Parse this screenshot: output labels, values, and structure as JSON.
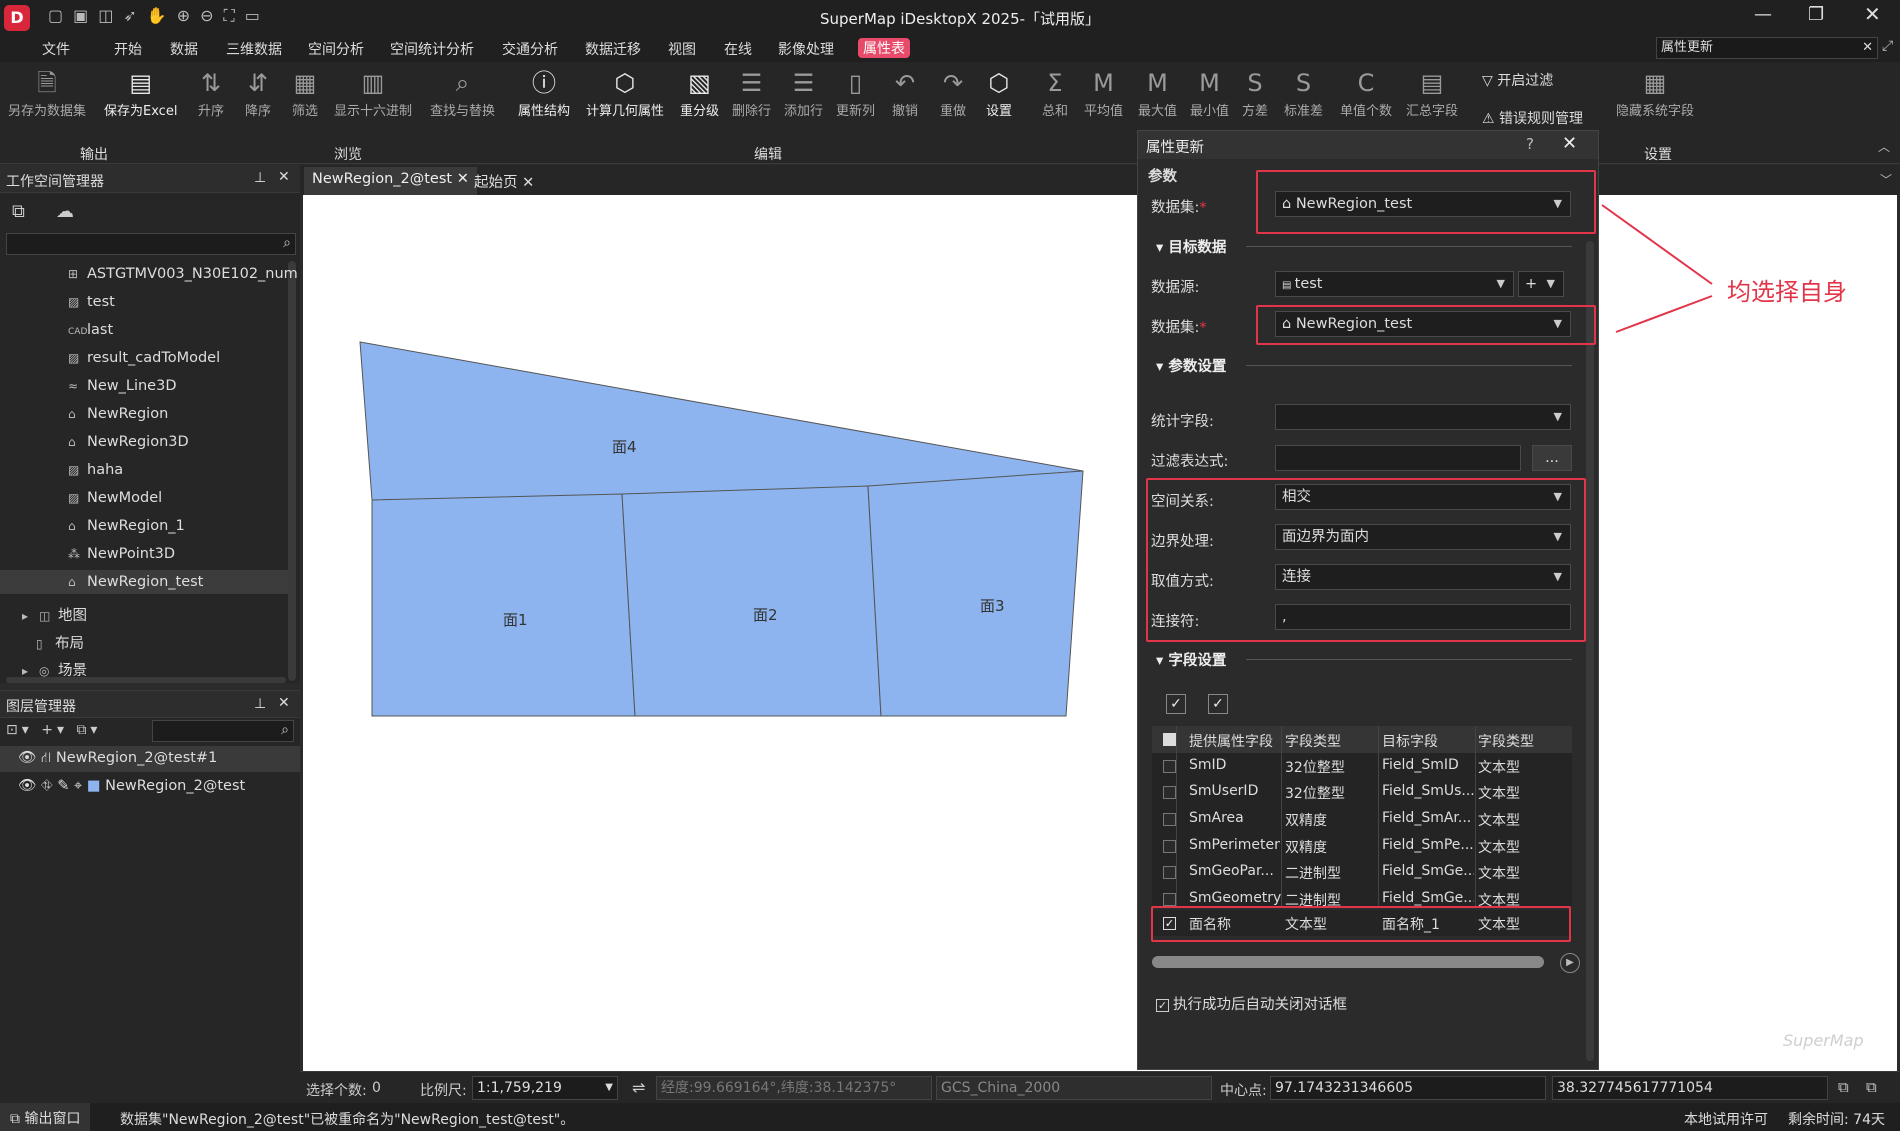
{
  "app": {
    "title": "SuperMap iDesktopX 2025-「试用版」",
    "search_value": "属性更新"
  },
  "menu": [
    "文件",
    "开始",
    "数据",
    "三维数据",
    "空间分析",
    "空间统计分析",
    "交通分析",
    "数据迁移",
    "视图",
    "在线",
    "影像处理",
    "属性表"
  ],
  "ribbon": {
    "output": [
      "另存为数据集",
      "保存为Excel"
    ],
    "browse": [
      "升序",
      "降序",
      "筛选",
      "显示十六进制",
      "查找与替换"
    ],
    "edit": [
      "属性结构",
      "计算几何属性",
      "重分级",
      "删除行",
      "添加行",
      "更新列",
      "撤销",
      "重做",
      "设置"
    ],
    "stats": [
      "总和",
      "平均值",
      "最大值",
      "最小值",
      "方差",
      "标准差",
      "单值个数",
      "汇总字段"
    ],
    "filter": "开启过滤",
    "error": "错误规则管理",
    "hide": "隐藏系统字段",
    "groups": [
      "输出",
      "浏览",
      "编辑",
      "设置"
    ]
  },
  "workspace": {
    "title": "工作空间管理器",
    "items": [
      "ASTGTMV003_N30E102_num",
      "test",
      "last",
      "result_cadToModel",
      "New_Line3D",
      "NewRegion",
      "NewRegion3D",
      "haha",
      "NewModel",
      "NewRegion_1",
      "NewPoint3D",
      "NewRegion_test"
    ],
    "nodes": [
      "地图",
      "布局",
      "场景"
    ]
  },
  "layers": {
    "title": "图层管理器",
    "items": [
      "NewRegion_2@test#1",
      "NewRegion_2@test"
    ]
  },
  "tabs": [
    "NewRegion_2@test",
    "起始页"
  ],
  "map": {
    "labels": [
      "面4",
      "面1",
      "面2",
      "面3"
    ]
  },
  "dialog": {
    "title": "属性更新",
    "params_label": "参数",
    "dataset_label": "数据集:",
    "dataset_value": "NewRegion_test",
    "target_section": "目标数据",
    "datasource_label": "数据源:",
    "datasource_value": "test",
    "target_dataset_label": "数据集:",
    "target_dataset_value": "NewRegion_test",
    "settings_section": "参数设置",
    "stat_field_label": "统计字段:",
    "filter_label": "过滤表达式:",
    "filter_btn": "...",
    "spatial_label": "空间关系:",
    "spatial_value": "相交",
    "boundary_label": "边界处理:",
    "boundary_value": "面边界为面内",
    "value_label": "取值方式:",
    "value_value": "连接",
    "joiner_label": "连接符:",
    "joiner_value": ",",
    "fields_section": "字段设置",
    "columns": [
      "提供属性字段",
      "字段类型",
      "目标字段",
      "字段类型"
    ],
    "rows": [
      [
        "SmID",
        "32位整型",
        "Field_SmID",
        "文本型"
      ],
      [
        "SmUserID",
        "32位整型",
        "Field_SmUs...",
        "文本型"
      ],
      [
        "SmArea",
        "双精度",
        "Field_SmAr...",
        "文本型"
      ],
      [
        "SmPerimeter",
        "双精度",
        "Field_SmPe...",
        "文本型"
      ],
      [
        "SmGeoPar...",
        "二进制型",
        "Field_SmGe...",
        "文本型"
      ],
      [
        "SmGeometry",
        "二进制型",
        "Field_SmGe...",
        "文本型"
      ],
      [
        "面名称",
        "文本型",
        "面名称_1",
        "文本型"
      ]
    ],
    "auto_close": "执行成功后自动关闭对话框"
  },
  "annotation": "均选择自身",
  "status": {
    "select_label": "选择个数:",
    "select_value": "0",
    "scale_label": "比例尺:",
    "scale_value": "1:1,759,219",
    "coords": "经度:99.669164°,纬度:38.142375°",
    "crs": "GCS_China_2000",
    "center_label": "中心点:",
    "center_x": "97.1743231346605",
    "center_y": "38.327745617771054"
  },
  "bottom": {
    "output_window": "输出窗口",
    "message": "数据集\"NewRegion_2@test\"已被重命名为\"NewRegion_test@test\"。",
    "license": "本地试用许可",
    "remaining": "剩余时间: 74天"
  },
  "colors": {
    "accent": "#e3354a",
    "map_fill": "#8db4ee",
    "menu_active": "#e84a6a"
  }
}
